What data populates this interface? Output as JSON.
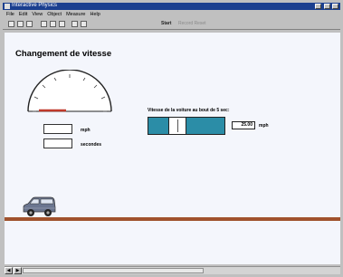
{
  "window": {
    "title": "Interactive Physics"
  },
  "menu": [
    "File",
    "Edit",
    "View",
    "Object",
    "Measure",
    "Help"
  ],
  "toolbar": {
    "start_label": "Start",
    "info_label": "Record  Reset"
  },
  "page": {
    "title": "Changement de vitesse"
  },
  "readouts": {
    "speed_unit": "mph",
    "time_unit": "secondes"
  },
  "control": {
    "question": "Vitesse de la voiture au bout de 5 sec:",
    "value": "25.00",
    "unit": "mph",
    "slider_fraction": 0.35
  },
  "colors": {
    "titlebar": "#1b3f8f",
    "slider": "#2b8da7",
    "road": "#a0522d",
    "needle": "#c0392b"
  }
}
